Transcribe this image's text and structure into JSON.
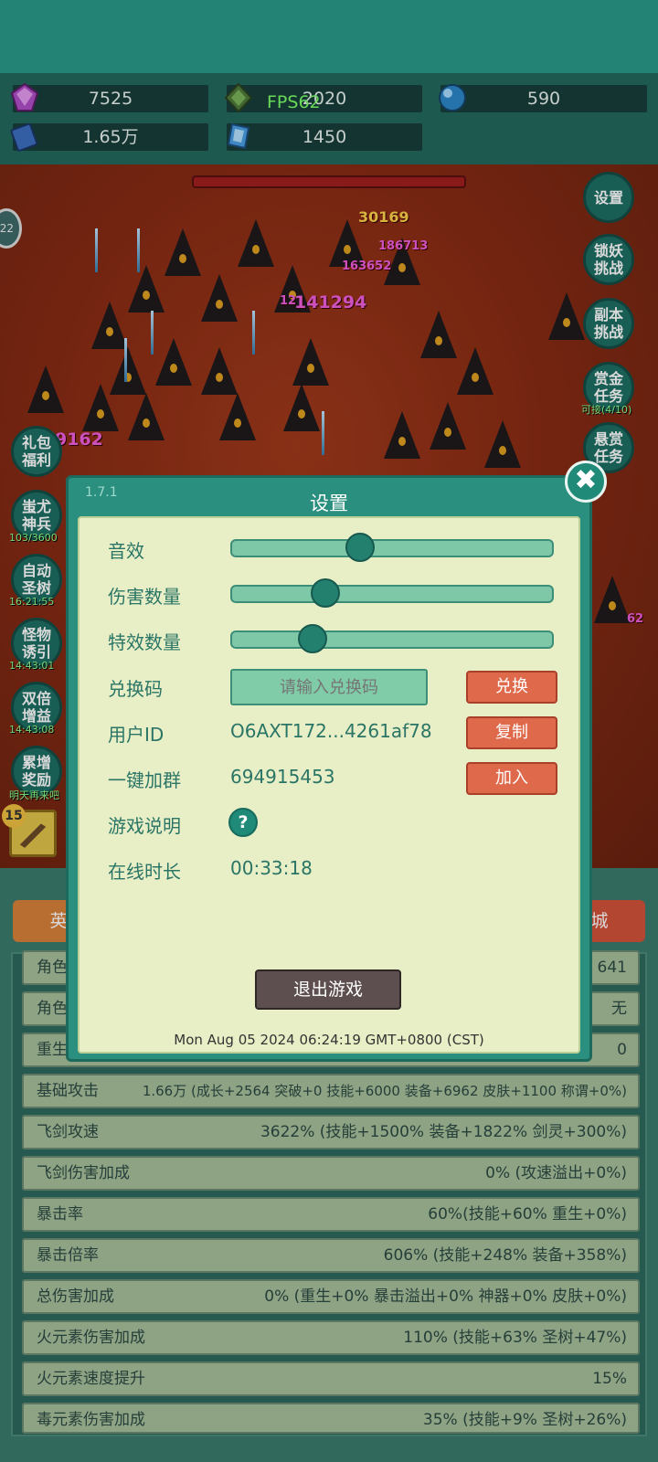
{
  "resources": {
    "gem": "7525",
    "emerald": "2020",
    "orb": "590",
    "book": "1.65万",
    "crystal": "1450"
  },
  "fps": "FPS62",
  "battle": {
    "damage_numbers": [
      "30169",
      "186713",
      "163652",
      "141294",
      "9162",
      "12",
      "62"
    ],
    "side_buttons": [
      "设置",
      "锁妖\n挑战",
      "副本\n挑战",
      "赏金\n任务",
      "悬赏\n任务"
    ],
    "bounty_sub": "可接(4/10)",
    "left_buttons": [
      {
        "label": "礼包\n福利",
        "sub": ""
      },
      {
        "label": "蚩尤\n神兵",
        "sub": "103/3600"
      },
      {
        "label": "自动\n圣树",
        "sub": "16:21:55"
      },
      {
        "label": "怪物\n诱引",
        "sub": "14:43:01"
      },
      {
        "label": "双倍\n增益",
        "sub": "14:43:08"
      },
      {
        "label": "累增\n奖励",
        "sub": "明天再来吧"
      }
    ],
    "level_badge": "15",
    "side_badge": "22"
  },
  "tabs": {
    "hero": "英",
    "shop": "城"
  },
  "stats": [
    {
      "label": "角色",
      "value": "641"
    },
    {
      "label": "角色",
      "value": "无"
    },
    {
      "label": "重生次数",
      "value": "0"
    },
    {
      "label": "基础攻击",
      "value": "1.66万 (成长+2564 突破+0 技能+6000 装备+6962 皮肤+1100 称谓+0%)"
    },
    {
      "label": "飞剑攻速",
      "value": "3622% (技能+1500% 装备+1822% 剑灵+300%)"
    },
    {
      "label": "飞剑伤害加成",
      "value": "0% (攻速溢出+0%)"
    },
    {
      "label": "暴击率",
      "value": "60%(技能+60% 重生+0%)"
    },
    {
      "label": "暴击倍率",
      "value": "606% (技能+248% 装备+358%)"
    },
    {
      "label": "总伤害加成",
      "value": "0% (重生+0% 暴击溢出+0% 神器+0% 皮肤+0%)"
    },
    {
      "label": "火元素伤害加成",
      "value": "110% (技能+63% 圣树+47%)"
    },
    {
      "label": "火元素速度提升",
      "value": "15%"
    },
    {
      "label": "毒元素伤害加成",
      "value": "35% (技能+9% 圣树+26%)"
    }
  ],
  "dialog": {
    "version": "1.7.1",
    "title": "设置",
    "sound_label": "音效",
    "sound_level": 0.4,
    "damage_count_label": "伤害数量",
    "damage_count_level": 0.29,
    "effect_count_label": "特效数量",
    "effect_count_level": 0.25,
    "redeem_label": "兑换码",
    "redeem_placeholder": "请输入兑换码",
    "redeem_button": "兑换",
    "user_id_label": "用户ID",
    "user_id_value": "O6AXT172...4261af78",
    "copy_button": "复制",
    "group_label": "一键加群",
    "group_value": "694915453",
    "join_button": "加入",
    "guide_label": "游戏说明",
    "guide_icon": "?",
    "online_label": "在线时长",
    "online_value": "00:33:18",
    "exit_button": "退出游戏",
    "datetime": "Mon Aug 05 2024 06:24:19 GMT+0800 (CST)",
    "close_icon": "✖"
  }
}
